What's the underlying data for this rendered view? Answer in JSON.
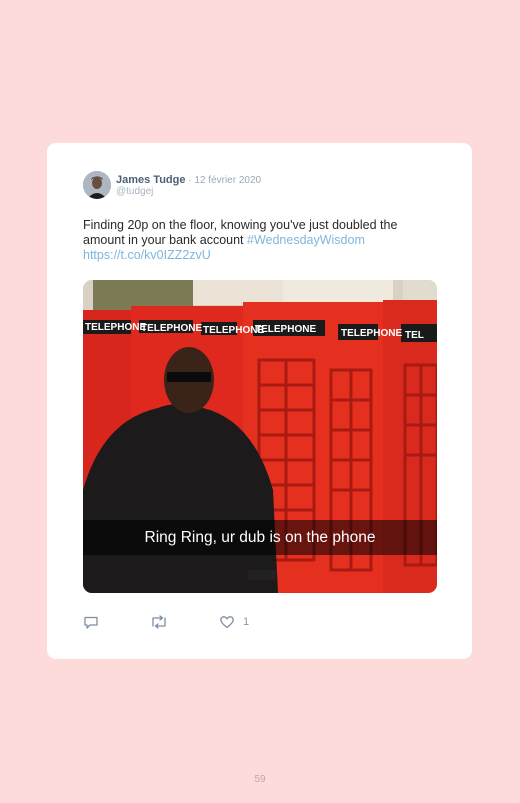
{
  "tweet": {
    "author_name": "James Tudge",
    "separator": " · ",
    "date": "12 février 2020",
    "handle": "@tudgej",
    "text": "Finding 20p on the floor, knowing you've just doubled the amount in your bank account ",
    "hashtag": "#WednesdayWisdom",
    "link": "https://t.co/kv0IZZ2zvU",
    "media": {
      "caption": "Ring Ring, ur dub is on the phone",
      "sign_labels": [
        "TELEPHONE",
        "TELEPHONE",
        "TELEPHONE",
        "TELEPHONE",
        "TELEPHONE",
        "TEL"
      ]
    },
    "actions": {
      "reply_icon": "reply-icon",
      "retweet_icon": "retweet-icon",
      "like_icon": "heart-icon",
      "like_count": "1"
    }
  },
  "page": {
    "number": "59"
  },
  "colors": {
    "background": "#fddbdb",
    "card": "#ffffff",
    "link": "#7fb6dd",
    "phone_box_red": "#e0291e"
  }
}
